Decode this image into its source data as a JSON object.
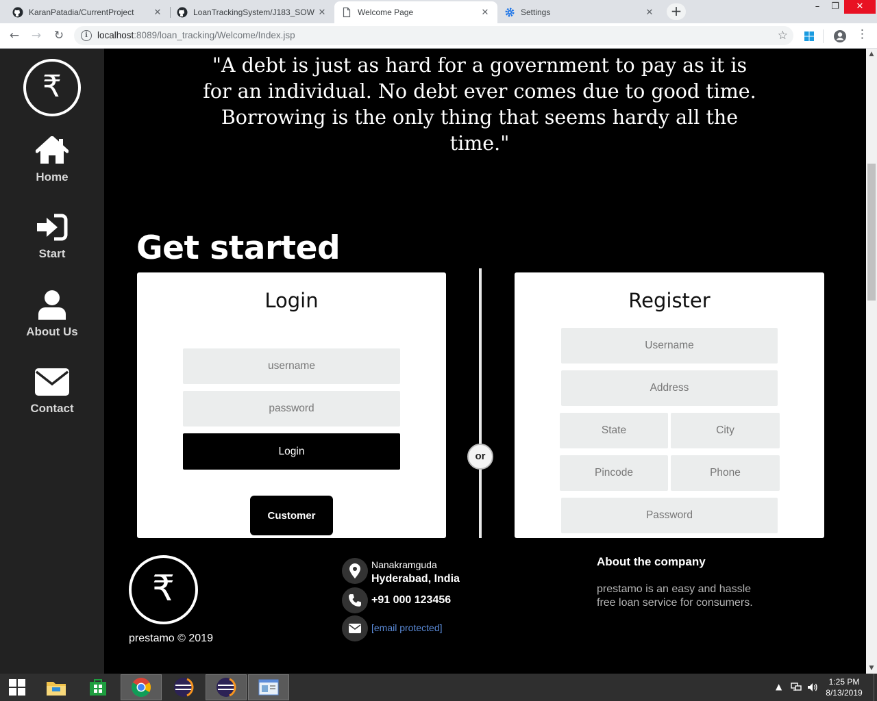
{
  "browser": {
    "tabs": [
      {
        "title": "KaranPatadia/CurrentProject",
        "icon": "github-icon"
      },
      {
        "title": "LoanTrackingSystem/J183_SOW",
        "icon": "github-icon"
      },
      {
        "title": "Welcome Page",
        "icon": "page-icon",
        "active": true
      },
      {
        "title": "Settings",
        "icon": "gear-icon"
      }
    ],
    "new_tab_label": "+",
    "url_host": "localhost",
    "url_rest": ":8089/loan_tracking/Welcome/Index.jsp"
  },
  "sidebar": {
    "logo_symbol": "₹",
    "items": [
      {
        "label": "Home",
        "icon": "home-icon"
      },
      {
        "label": "Start",
        "icon": "sign-in-icon"
      },
      {
        "label": "About Us",
        "icon": "user-icon"
      },
      {
        "label": "Contact",
        "icon": "envelope-icon"
      }
    ]
  },
  "quote": "\"A debt is just as hard for a government to pay as it is for an individual. No debt ever comes due to good time. Borrowing is the only thing that seems hardy all the time.\"",
  "get_started": "Get started",
  "login": {
    "title": "Login",
    "username_placeholder": "username",
    "password_placeholder": "password",
    "button_label": "Login",
    "customer_label": "Customer"
  },
  "divider_label": "or",
  "register": {
    "title": "Register",
    "username_placeholder": "Username",
    "address_placeholder": "Address",
    "state_placeholder": "State",
    "city_placeholder": "City",
    "pincode_placeholder": "Pincode",
    "phone_placeholder": "Phone",
    "password_placeholder": "Password"
  },
  "footer": {
    "logo_symbol": "₹",
    "copyright": "prestamo © 2019",
    "address_line1": "Nanakramguda",
    "address_line2": "Hyderabad, India",
    "phone": "+91 000 123456",
    "email": "[email protected]",
    "about_title": "About the company",
    "about_text": "prestamo is an easy and hassle free loan service for consumers."
  },
  "taskbar": {
    "time": "1:25 PM",
    "date": "8/13/2019"
  },
  "colors": {
    "sidebar_bg": "#222222",
    "page_bg": "#000000",
    "field_bg": "#ebeded",
    "link_blue": "#5b8bd9"
  }
}
